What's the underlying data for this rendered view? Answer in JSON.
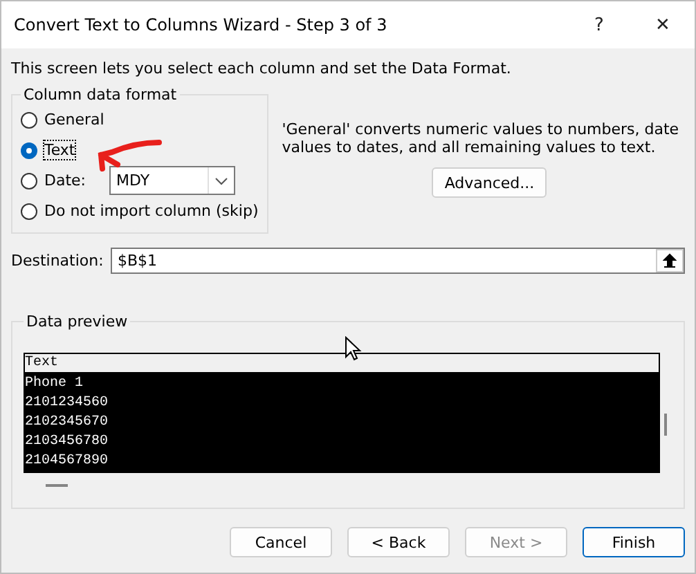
{
  "window": {
    "title": "Convert Text to Columns Wizard - Step 3 of 3",
    "help": "?",
    "close": "✕"
  },
  "description": "This screen lets you select each column and set the Data Format.",
  "column_data_format": {
    "legend": "Column data format",
    "options": [
      {
        "kind": "radio",
        "label": "General",
        "selected": false
      },
      {
        "kind": "radio",
        "label": "Text",
        "selected": true
      },
      {
        "kind": "date",
        "label": "Date:",
        "selected": false,
        "value": "MDY"
      },
      {
        "kind": "radio",
        "label": "Do not import column (skip)",
        "selected": false
      }
    ]
  },
  "info": "'General' converts numeric values to numbers, date values to dates, and all remaining values to text.",
  "advanced_button": "Advanced...",
  "destination": {
    "label": "Destination:",
    "value": "$B$1"
  },
  "data_preview": {
    "legend": "Data preview",
    "header": "Text",
    "rows": [
      "Phone 1",
      "2101234560",
      "2102345670",
      "2103456780",
      "2104567890"
    ]
  },
  "buttons": [
    {
      "label": "Cancel",
      "disabled": false,
      "default": false
    },
    {
      "label": "< Back",
      "disabled": false,
      "default": false
    },
    {
      "label": "Next >",
      "disabled": true,
      "default": false
    },
    {
      "label": "Finish",
      "disabled": false,
      "default": true
    }
  ]
}
